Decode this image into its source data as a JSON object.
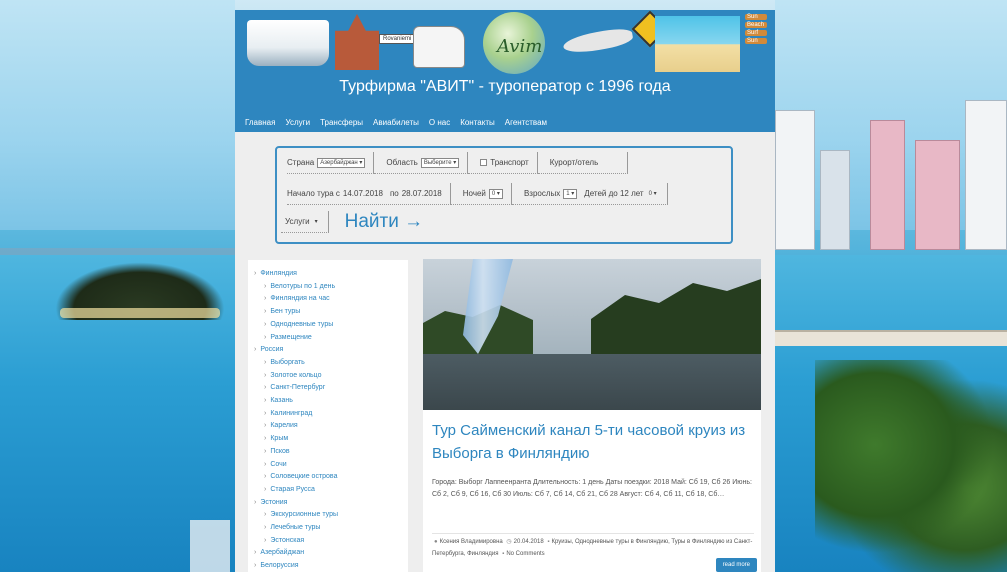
{
  "header": {
    "site_title": "Турфирма \"АВИТ\" - туроператор с 1996 года",
    "banner_signs": [
      "Rovaniemi",
      "Sun",
      "Beach",
      "Surf",
      "Sun"
    ],
    "logo_text": "Avim"
  },
  "nav": {
    "items": [
      "Главная",
      "Услуги",
      "Трансферы",
      "Авиабилеты",
      "О нас",
      "Контакты",
      "Агентствам"
    ]
  },
  "search": {
    "country_label": "Страна",
    "country_value": "Азербайджан",
    "region_label": "Область",
    "region_value": "Выберите",
    "transport_label": "Транспорт",
    "resort_label": "Курорт/отель",
    "tour_start_label": "Начало тура с",
    "date_from": "14.07.2018",
    "date_to_label": "по",
    "date_to": "28.07.2018",
    "nights_label": "Ночей",
    "nights_value": "0",
    "adults_label": "Взрослых",
    "adults_value": "1",
    "children_label": "Детей до 12 лет",
    "children_value": "0",
    "services_label": "Услуги",
    "services_value": "",
    "find_label": "Найти →"
  },
  "sidebar": {
    "items": [
      {
        "label": "Финляндия",
        "sub": false
      },
      {
        "label": "Велотуры по 1 день",
        "sub": true
      },
      {
        "label": "Финляндия на час",
        "sub": true
      },
      {
        "label": "Бен туры",
        "sub": true
      },
      {
        "label": "Однодневные туры",
        "sub": true
      },
      {
        "label": "Размещение",
        "sub": true
      },
      {
        "label": "Россия",
        "sub": false
      },
      {
        "label": "Выборгать",
        "sub": true
      },
      {
        "label": "Золотое кольцо",
        "sub": true
      },
      {
        "label": "Санкт-Петербург",
        "sub": true
      },
      {
        "label": "Казань",
        "sub": true
      },
      {
        "label": "Калининград",
        "sub": true
      },
      {
        "label": "Карелия",
        "sub": true
      },
      {
        "label": "Крым",
        "sub": true
      },
      {
        "label": "Псков",
        "sub": true
      },
      {
        "label": "Сочи",
        "sub": true
      },
      {
        "label": "Соловецкие острова",
        "sub": true
      },
      {
        "label": "Старая Русса",
        "sub": true
      },
      {
        "label": "Эстония",
        "sub": false
      },
      {
        "label": "Экскурсионные туры",
        "sub": true
      },
      {
        "label": "Лечебные туры",
        "sub": true
      },
      {
        "label": "Эстонская",
        "sub": true
      },
      {
        "label": "Азербайджан",
        "sub": false
      },
      {
        "label": "Белоруссия",
        "sub": false
      }
    ]
  },
  "article": {
    "title": "Тур Сайменский канал 5-ти часовой круиз из Выборга в Финляндию",
    "excerpt": "Города: Выборг Лаппеенранта Длительность: 1 день Даты поездки: 2018 Май: Сб 19, Сб 26 Июнь: Сб 2, Сб 9, Сб 16, Сб 30 Июль: Сб 7, Сб 14, Сб 21, Сб 28 Август: Сб 4, Сб 11, Сб 18, Сб…",
    "author": "Ксения Владимировна",
    "date": "20.04.2018",
    "categories": "Круизы, Однодневные туры в Финляндию, Туры в Финляндию из Санкт-Петербурга, Финляндия",
    "comments": "No Comments",
    "read_more": "read more"
  },
  "colors": {
    "accent": "#2e86bf",
    "header_bg": "#2e86bf",
    "content_bg": "#eeeeee"
  }
}
